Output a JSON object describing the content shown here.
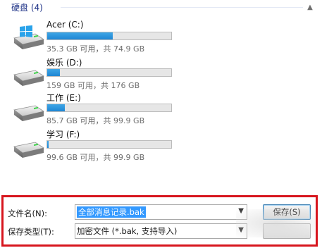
{
  "group": {
    "title": "硬盘 (4)",
    "collapse_icon": "chevron-up-icon"
  },
  "drives": [
    {
      "name": "Acer (C:)",
      "space_text": "35.3 GB 可用，共 74.9 GB",
      "used_fraction": 0.53,
      "has_windows_logo": true
    },
    {
      "name": "娱乐 (D:)",
      "space_text": "159 GB 可用，共 176 GB",
      "used_fraction": 0.1,
      "has_windows_logo": false
    },
    {
      "name": "工作 (E:)",
      "space_text": "85.7 GB 可用，共 99.9 GB",
      "used_fraction": 0.14,
      "has_windows_logo": false
    },
    {
      "name": "学习 (F:)",
      "space_text": "99.6 GB 可用，共 99.9 GB",
      "used_fraction": 0.01,
      "has_windows_logo": false
    }
  ],
  "save_panel": {
    "filename_label": "文件名(N):",
    "filename_value": "全部消息记录.bak",
    "filetype_label": "保存类型(T):",
    "filetype_value": "加密文件 (*.bak, 支持导入)",
    "save_button": "保存(S)",
    "cancel_button": ""
  },
  "colors": {
    "accent": "#1f86d4",
    "highlight": "#d7151d",
    "selection": "#3399ff"
  }
}
